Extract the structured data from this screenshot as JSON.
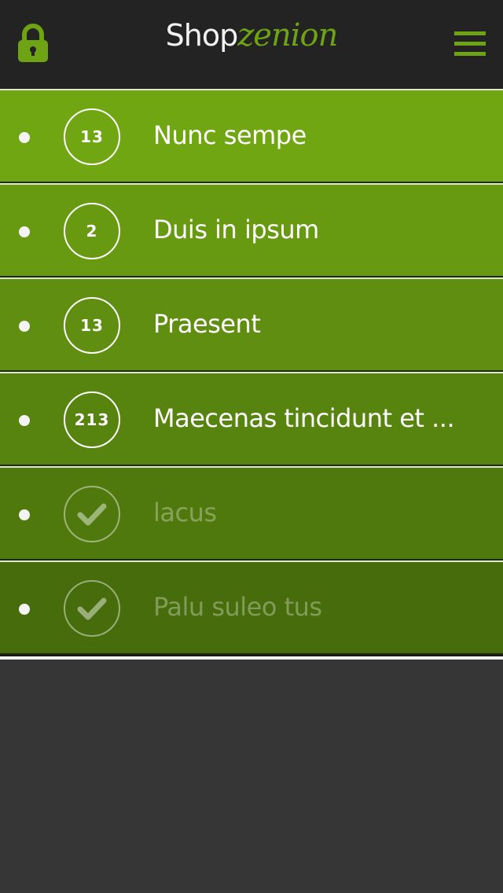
{
  "header": {
    "brand_part1": "Shop",
    "brand_part2": "zenion",
    "lock_icon": "lock-icon",
    "menu_icon": "hamburger-menu-icon"
  },
  "colors": {
    "accent": "#6ea414",
    "header_bg": "#232323",
    "page_bg": "#363636"
  },
  "items": [
    {
      "count": "13",
      "label": "Nunc sempe",
      "done": false
    },
    {
      "count": "2",
      "label": "Duis in ipsum",
      "done": false
    },
    {
      "count": "13",
      "label": "Praesent",
      "done": false
    },
    {
      "count": "213",
      "label": "Maecenas tincidunt et ...",
      "done": false
    },
    {
      "count": "",
      "label": "lacus",
      "done": true,
      "icon": "check-icon"
    },
    {
      "count": "",
      "label": "Palu suleo tus",
      "done": true,
      "icon": "check-icon"
    }
  ]
}
